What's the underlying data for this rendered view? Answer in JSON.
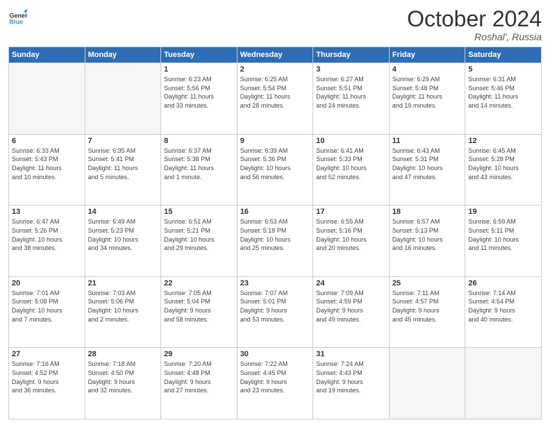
{
  "header": {
    "logo_line1": "General",
    "logo_line2": "Blue",
    "month_title": "October 2024",
    "location": "Roshal', Russia"
  },
  "days_of_week": [
    "Sunday",
    "Monday",
    "Tuesday",
    "Wednesday",
    "Thursday",
    "Friday",
    "Saturday"
  ],
  "weeks": [
    [
      {
        "day": "",
        "info": ""
      },
      {
        "day": "",
        "info": ""
      },
      {
        "day": "1",
        "info": "Sunrise: 6:23 AM\nSunset: 5:56 PM\nDaylight: 11 hours\nand 33 minutes."
      },
      {
        "day": "2",
        "info": "Sunrise: 6:25 AM\nSunset: 5:54 PM\nDaylight: 11 hours\nand 28 minutes."
      },
      {
        "day": "3",
        "info": "Sunrise: 6:27 AM\nSunset: 5:51 PM\nDaylight: 11 hours\nand 24 minutes."
      },
      {
        "day": "4",
        "info": "Sunrise: 6:29 AM\nSunset: 5:48 PM\nDaylight: 11 hours\nand 19 minutes."
      },
      {
        "day": "5",
        "info": "Sunrise: 6:31 AM\nSunset: 5:46 PM\nDaylight: 11 hours\nand 14 minutes."
      }
    ],
    [
      {
        "day": "6",
        "info": "Sunrise: 6:33 AM\nSunset: 5:43 PM\nDaylight: 11 hours\nand 10 minutes."
      },
      {
        "day": "7",
        "info": "Sunrise: 6:35 AM\nSunset: 5:41 PM\nDaylight: 11 hours\nand 5 minutes."
      },
      {
        "day": "8",
        "info": "Sunrise: 6:37 AM\nSunset: 5:38 PM\nDaylight: 11 hours\nand 1 minute."
      },
      {
        "day": "9",
        "info": "Sunrise: 6:39 AM\nSunset: 5:36 PM\nDaylight: 10 hours\nand 56 minutes."
      },
      {
        "day": "10",
        "info": "Sunrise: 6:41 AM\nSunset: 5:33 PM\nDaylight: 10 hours\nand 52 minutes."
      },
      {
        "day": "11",
        "info": "Sunrise: 6:43 AM\nSunset: 5:31 PM\nDaylight: 10 hours\nand 47 minutes."
      },
      {
        "day": "12",
        "info": "Sunrise: 6:45 AM\nSunset: 5:28 PM\nDaylight: 10 hours\nand 43 minutes."
      }
    ],
    [
      {
        "day": "13",
        "info": "Sunrise: 6:47 AM\nSunset: 5:26 PM\nDaylight: 10 hours\nand 38 minutes."
      },
      {
        "day": "14",
        "info": "Sunrise: 6:49 AM\nSunset: 5:23 PM\nDaylight: 10 hours\nand 34 minutes."
      },
      {
        "day": "15",
        "info": "Sunrise: 6:51 AM\nSunset: 5:21 PM\nDaylight: 10 hours\nand 29 minutes."
      },
      {
        "day": "16",
        "info": "Sunrise: 6:53 AM\nSunset: 5:18 PM\nDaylight: 10 hours\nand 25 minutes."
      },
      {
        "day": "17",
        "info": "Sunrise: 6:55 AM\nSunset: 5:16 PM\nDaylight: 10 hours\nand 20 minutes."
      },
      {
        "day": "18",
        "info": "Sunrise: 6:57 AM\nSunset: 5:13 PM\nDaylight: 10 hours\nand 16 minutes."
      },
      {
        "day": "19",
        "info": "Sunrise: 6:59 AM\nSunset: 5:11 PM\nDaylight: 10 hours\nand 11 minutes."
      }
    ],
    [
      {
        "day": "20",
        "info": "Sunrise: 7:01 AM\nSunset: 5:08 PM\nDaylight: 10 hours\nand 7 minutes."
      },
      {
        "day": "21",
        "info": "Sunrise: 7:03 AM\nSunset: 5:06 PM\nDaylight: 10 hours\nand 2 minutes."
      },
      {
        "day": "22",
        "info": "Sunrise: 7:05 AM\nSunset: 5:04 PM\nDaylight: 9 hours\nand 58 minutes."
      },
      {
        "day": "23",
        "info": "Sunrise: 7:07 AM\nSunset: 5:01 PM\nDaylight: 9 hours\nand 53 minutes."
      },
      {
        "day": "24",
        "info": "Sunrise: 7:09 AM\nSunset: 4:59 PM\nDaylight: 9 hours\nand 49 minutes."
      },
      {
        "day": "25",
        "info": "Sunrise: 7:11 AM\nSunset: 4:57 PM\nDaylight: 9 hours\nand 45 minutes."
      },
      {
        "day": "26",
        "info": "Sunrise: 7:14 AM\nSunset: 4:54 PM\nDaylight: 9 hours\nand 40 minutes."
      }
    ],
    [
      {
        "day": "27",
        "info": "Sunrise: 7:16 AM\nSunset: 4:52 PM\nDaylight: 9 hours\nand 36 minutes."
      },
      {
        "day": "28",
        "info": "Sunrise: 7:18 AM\nSunset: 4:50 PM\nDaylight: 9 hours\nand 32 minutes."
      },
      {
        "day": "29",
        "info": "Sunrise: 7:20 AM\nSunset: 4:48 PM\nDaylight: 9 hours\nand 27 minutes."
      },
      {
        "day": "30",
        "info": "Sunrise: 7:22 AM\nSunset: 4:45 PM\nDaylight: 9 hours\nand 23 minutes."
      },
      {
        "day": "31",
        "info": "Sunrise: 7:24 AM\nSunset: 4:43 PM\nDaylight: 9 hours\nand 19 minutes."
      },
      {
        "day": "",
        "info": ""
      },
      {
        "day": "",
        "info": ""
      }
    ]
  ]
}
